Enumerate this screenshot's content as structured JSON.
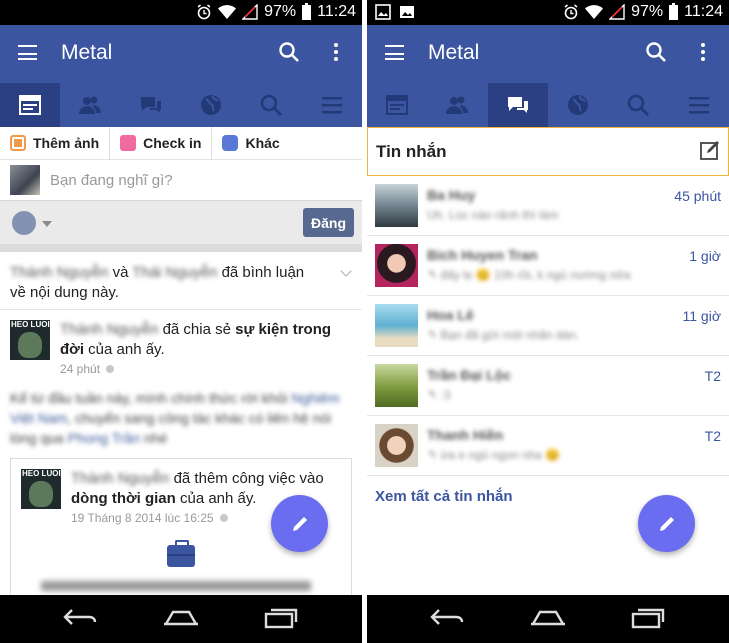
{
  "status_bar": {
    "battery": "97%",
    "time": "11:24"
  },
  "app": {
    "title": "Metal"
  },
  "tabs": [
    "news-feed",
    "friends",
    "messages",
    "notifications",
    "search",
    "more"
  ],
  "composer": {
    "actions": [
      {
        "label": "Thêm ảnh",
        "icon": "photo-icon",
        "color": "#f39a4a"
      },
      {
        "label": "Check in",
        "icon": "location-icon",
        "color": "#f06b9f"
      },
      {
        "label": "Khác",
        "icon": "smiley-icon",
        "color": "#5a79d6"
      }
    ],
    "placeholder": "Bạn đang nghĩ gì?",
    "post_button": "Đăng"
  },
  "feed": {
    "story_header": {
      "name1": "Thành Nguyễn",
      "and": "và",
      "name2": "Thái Nguyễn",
      "action": "đã bình luận",
      "rest": "về nội dung này."
    },
    "post": {
      "avatar_label": "HEO LUOI",
      "author": "Thành Nguyễn",
      "action": "đã chia sẻ",
      "bold": "sự kiện trong đời",
      "rest": "của anh ấy.",
      "time": "24 phút",
      "body": "Kể từ đầu tuần này, mình chính thức rời khỏi",
      "body_link1": "Nghiêm Việt Nam",
      "body_mid": ", chuyển sang công tác khác có liên hệ nói lòng qua",
      "body_link2": "Phong Trần",
      "body_end": "nhé"
    },
    "shared": {
      "avatar_label": "HEO LUOI",
      "author": "Thành Nguyễn",
      "action": "đã thêm công việc vào",
      "bold": "dòng thời gian",
      "rest": "của anh ấy.",
      "date": "19 Tháng 8 2014 lúc 16:25"
    }
  },
  "messages": {
    "title": "Tin nhắn",
    "items": [
      {
        "name": "Ba Huy",
        "preview": "Uh. Lúc nào rảnh thì làm",
        "time": "45 phút",
        "avatar_color": "#6b7d88"
      },
      {
        "name": "Bich Huyen Tran",
        "preview": "↰ đấy lẹ 😊 10h rồi, k ngủ nướng nữa",
        "time": "1 giờ",
        "avatar_color": "#7a3a52"
      },
      {
        "name": "Hoa Lê",
        "preview": "↰ Bạn đã gửi một nhãn dán.",
        "time": "11 giờ",
        "avatar_color": "#5fb0d0"
      },
      {
        "name": "Trần Đại Lộc",
        "preview": "↰ :3",
        "time": "T2",
        "avatar_color": "#7d9a3c"
      },
      {
        "name": "Thanh Hiền",
        "preview": "↰ ừa e ngủ ngon nha 😊",
        "time": "T2",
        "avatar_color": "#b79a7a"
      }
    ],
    "see_all": "Xem tất cả tin nhắn"
  }
}
